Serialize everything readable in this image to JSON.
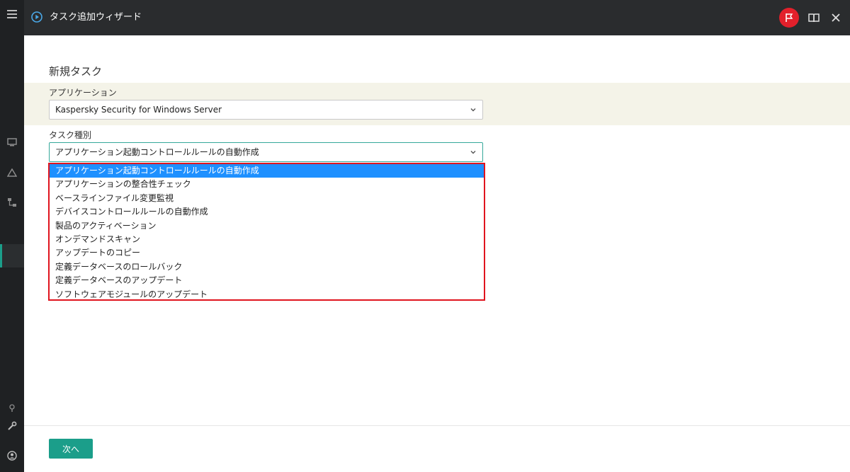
{
  "window": {
    "title": "タスク追加ウィザード"
  },
  "header_icons": [
    "play-circle-icon",
    "flag-icon",
    "book-icon",
    "close-icon"
  ],
  "sidebar_icons": [
    "menu-icon",
    "monitor-icon",
    "warning-icon",
    "tree-icon",
    "key-icon",
    "wrench-icon",
    "user-icon"
  ],
  "page": {
    "title": "新規タスク"
  },
  "application": {
    "label": "アプリケーション",
    "value": "Kaspersky Security for Windows Server"
  },
  "task_type": {
    "label": "タスク種別",
    "value": "アプリケーション起動コントロールルールの自動作成",
    "options": [
      "アプリケーション起動コントロールルールの自動作成",
      "アプリケーションの整合性チェック",
      "ベースラインファイル変更監視",
      "デバイスコントロールルールの自動作成",
      "製品のアクティベーション",
      "オンデマンドスキャン",
      "アップデートのコピー",
      "定義データベースのロールバック",
      "定義データベースのアップデート",
      "ソフトウェアモジュールのアップデート"
    ],
    "selected_index": 0
  },
  "footer": {
    "next_label": "次へ"
  },
  "colors": {
    "accent": "#1b9e8a",
    "highlight_border": "#e0141e",
    "selected_option": "#1e90ff",
    "header_bg": "#2a2c2e",
    "flag_bg": "#e2202b",
    "band_bg": "#f4f3e8"
  }
}
